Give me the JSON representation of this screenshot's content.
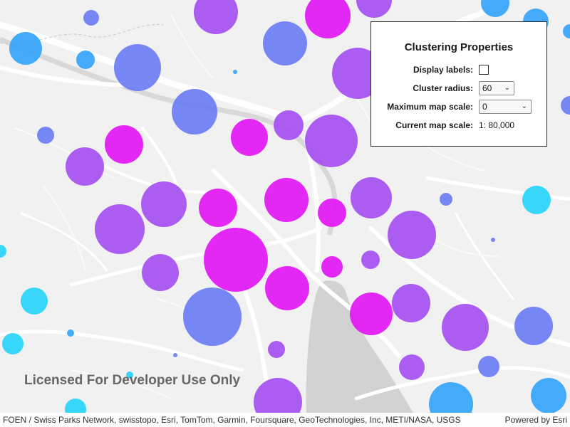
{
  "panel": {
    "title": "Clustering Properties",
    "display_labels_label": "Display labels:",
    "display_labels_checked": false,
    "cluster_radius_label": "Cluster radius:",
    "cluster_radius_value": "60",
    "max_scale_label": "Maximum map scale:",
    "max_scale_value": "0",
    "current_scale_label": "Current map scale:",
    "current_scale_value": "1: 80,000"
  },
  "map": {
    "watermark": "Licensed For Developer Use Only",
    "attribution": "FOEN / Swiss Parks Network, swisstopo, Esri, TomTom, Garmin, Foursquare, GeoTechnologies, Inc, METI/NASA, USGS",
    "powered_by": "Powered by Esri",
    "colors": {
      "cyan": "#2dd4f8",
      "sky": "#3aa6fb",
      "blue": "#6f7ff3",
      "violet": "#a653f0",
      "magenta": "#e21cf5",
      "lake": "#d2d2d2",
      "road": "#ffffff",
      "land": "#f1f1f1"
    }
  }
}
